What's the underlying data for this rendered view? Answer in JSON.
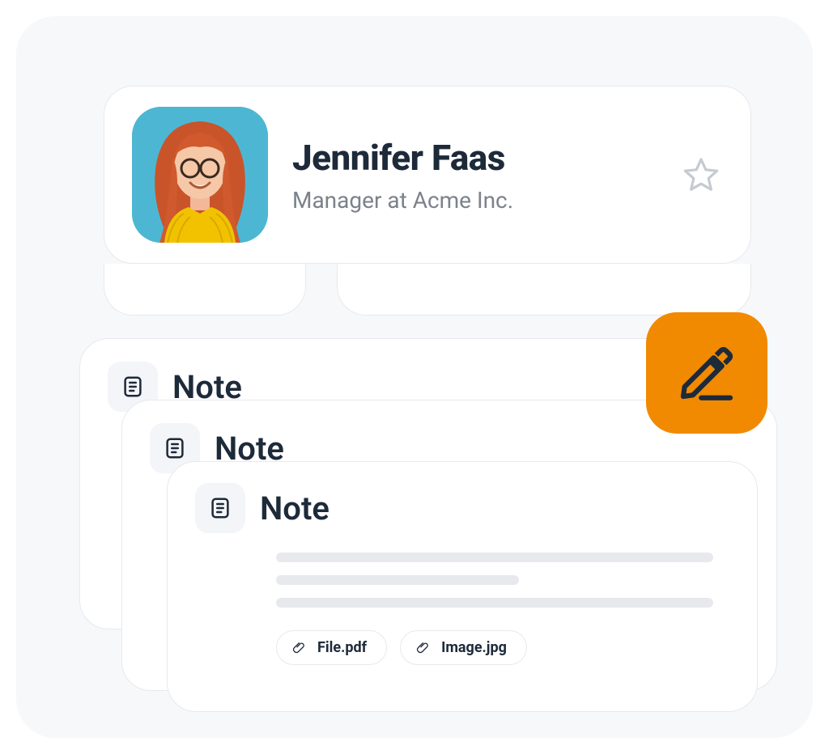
{
  "contact": {
    "name": "Jennifer Faas",
    "subtitle": "Manager at Acme Inc."
  },
  "notes": {
    "card1_title": "Note",
    "card2_title": "Note",
    "card3_title": "Note"
  },
  "attachments": [
    {
      "label": "File.pdf"
    },
    {
      "label": "Image.jpg"
    }
  ],
  "icons": {
    "star": "star-icon",
    "note": "note-icon",
    "edit": "edit-pencil-icon",
    "paperclip": "paperclip-icon"
  },
  "colors": {
    "accent": "#f18a00",
    "text": "#1d2a3a",
    "muted": "#7b828b",
    "border": "#e7e9ed"
  }
}
